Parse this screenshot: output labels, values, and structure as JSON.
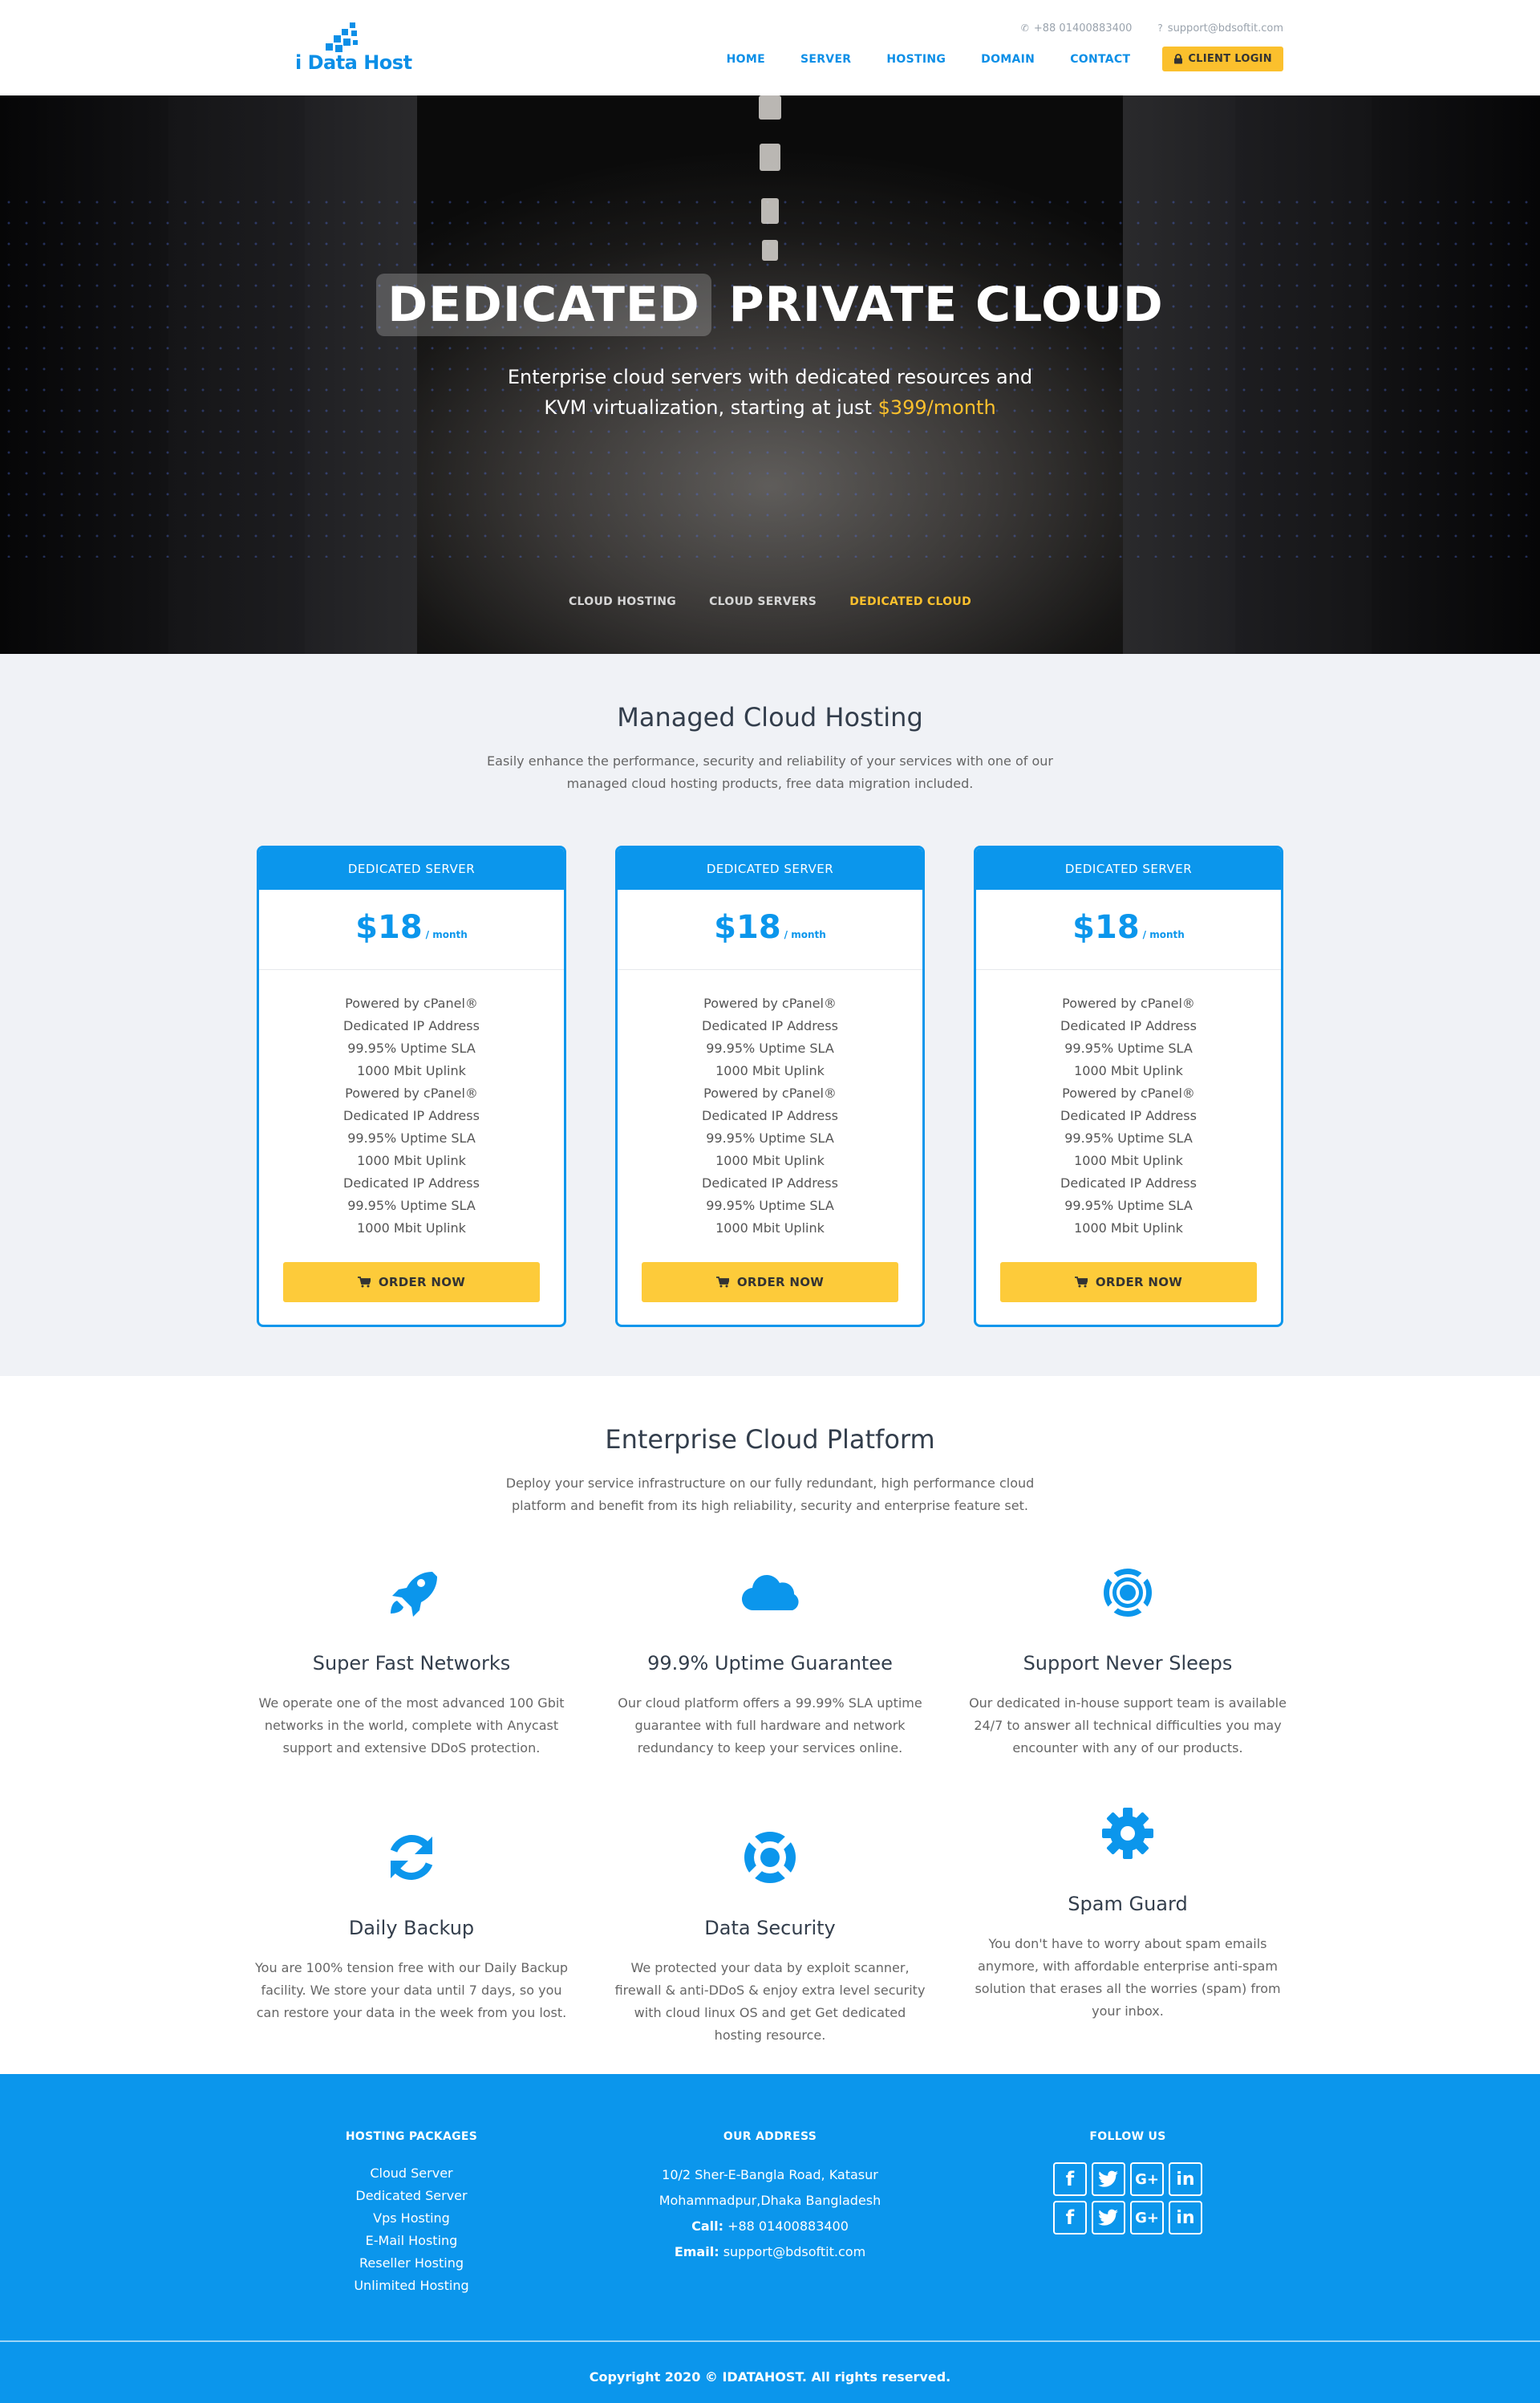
{
  "header": {
    "logo_text": "i Data Host",
    "phone": "+88 01400883400",
    "email": "support@bdsoftit.com",
    "nav": [
      "HOME",
      "SERVER",
      "HOSTING",
      "DOMAIN",
      "CONTACT"
    ],
    "client_login": "CLIENT LOGIN"
  },
  "hero": {
    "title_highlight": "DEDICATED",
    "title_rest": "PRIVATE CLOUD",
    "subtitle_line1": "Enterprise cloud servers with dedicated resources and",
    "subtitle_line2": "KVM virtualization, starting at just",
    "price": "$399/month",
    "tabs": [
      "CLOUD HOSTING",
      "CLOUD SERVERS",
      "DEDICATED CLOUD"
    ],
    "active_tab": "DEDICATED CLOUD"
  },
  "pricing": {
    "title": "Managed Cloud Hosting",
    "subtitle": "Easily enhance the performance, security and reliability of your services with one of our managed cloud hosting products, free data migration included.",
    "cards": [
      {
        "name": "DEDICATED SERVER",
        "price": "$18",
        "period": "/ month",
        "features": [
          "Powered by cPanel®",
          "Dedicated IP Address",
          "99.95% Uptime SLA",
          "1000 Mbit Uplink",
          "Powered by cPanel®",
          "Dedicated IP Address",
          "99.95% Uptime SLA",
          "1000 Mbit Uplink",
          "Dedicated IP Address",
          "99.95% Uptime SLA",
          "1000 Mbit Uplink"
        ],
        "button": "ORDER NOW"
      },
      {
        "name": "DEDICATED SERVER",
        "price": "$18",
        "period": "/ month",
        "features": [
          "Powered by cPanel®",
          "Dedicated IP Address",
          "99.95% Uptime SLA",
          "1000 Mbit Uplink",
          "Powered by cPanel®",
          "Dedicated IP Address",
          "99.95% Uptime SLA",
          "1000 Mbit Uplink",
          "Dedicated IP Address",
          "99.95% Uptime SLA",
          "1000 Mbit Uplink"
        ],
        "button": "ORDER NOW"
      },
      {
        "name": "DEDICATED SERVER",
        "price": "$18",
        "period": "/ month",
        "features": [
          "Powered by cPanel®",
          "Dedicated IP Address",
          "99.95% Uptime SLA",
          "1000 Mbit Uplink",
          "Powered by cPanel®",
          "Dedicated IP Address",
          "99.95% Uptime SLA",
          "1000 Mbit Uplink",
          "Dedicated IP Address",
          "99.95% Uptime SLA",
          "1000 Mbit Uplink"
        ],
        "button": "ORDER NOW"
      }
    ]
  },
  "features": {
    "title": "Enterprise Cloud Platform",
    "subtitle": "Deploy your service infrastructure on our fully redundant, high performance cloud platform and benefit from its high reliability, security and enterprise feature set.",
    "items": [
      {
        "icon": "rocket-icon",
        "title": "Super Fast Networks",
        "text": "We operate one of the most advanced 100 Gbit networks in the world, complete with Anycast support and extensive DDoS protection."
      },
      {
        "icon": "cloud-icon",
        "title": "99.9% Uptime Guarantee",
        "text": "Our cloud platform offers a 99.99% SLA uptime guarantee with full hardware and network redundancy to keep your services online."
      },
      {
        "icon": "lifebuoy-icon",
        "title": "Support Never Sleeps",
        "text": "Our dedicated in-house support team is available 24/7 to answer all technical difficulties you may encounter with any of our products."
      },
      {
        "icon": "refresh-icon",
        "title": "Daily Backup",
        "text": "You are 100% tension free with our Daily Backup facility. We store your data until 7 days, so you can restore your data in the week from you lost."
      },
      {
        "icon": "lifebuoy-icon",
        "title": "Data Security",
        "text": "We protected your data by exploit scanner, firewall & anti-DDoS & enjoy extra level security with cloud linux OS and get Get dedicated hosting resource."
      },
      {
        "icon": "gear-icon",
        "title": "Spam Guard",
        "text": "You don't have to worry about spam emails anymore, with affordable enterprise anti-spam solution that erases all the worries (spam) from your inbox."
      }
    ]
  },
  "footer": {
    "packages_title": "HOSTING PACKAGES",
    "packages": [
      "Cloud Server",
      "Dedicated Server",
      "Vps Hosting",
      "E-Mail Hosting",
      "Reseller Hosting",
      "Unlimited Hosting"
    ],
    "address_title": "OUR ADDRESS",
    "address_line1": "10/2 Sher-E-Bangla Road, Katasur",
    "address_line2": "Mohammadpur,Dhaka Bangladesh",
    "call_label": "Call:",
    "call_value": "+88 01400883400",
    "email_label": "Email:",
    "email_value": "support@bdsoftit.com",
    "follow_title": "FOLLOW US",
    "social": [
      "f",
      "t",
      "G+",
      "in"
    ],
    "copyright": "Copyright 2020 © IDATAHOST. All rights reserved."
  },
  "colors": {
    "primary": "#0b96ec",
    "accent": "#fbc02d"
  }
}
